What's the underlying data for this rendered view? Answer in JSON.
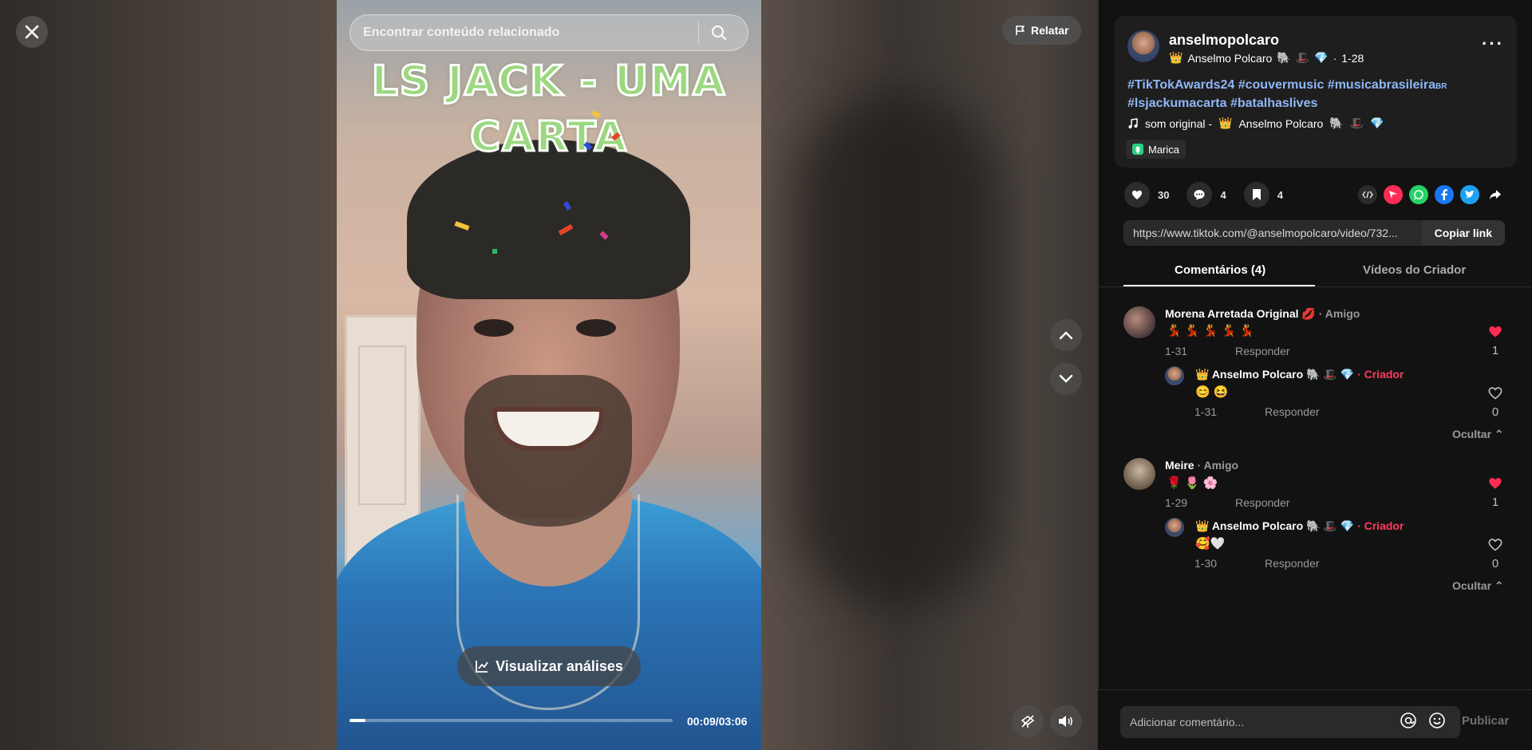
{
  "header": {
    "search_placeholder": "Encontrar conteúdo relacionado",
    "report_label": "Relatar"
  },
  "video": {
    "overlay_title_line1": "LS JACK  -  UMA",
    "overlay_title_line2": "CARTA",
    "analytics_label": "Visualizar análises",
    "timer": "00:09/03:06",
    "progress_fraction": 0.05
  },
  "post": {
    "username": "anselmopolcaro",
    "display_name": "Anselmo Polcaro",
    "date": "1-28",
    "caption_line1": "#TikTokAwards24 #couvermusic #musicabrasileira",
    "caption_flag": "BR",
    "caption_line2": "#lsjackumacarta #batalhaslives",
    "music_prefix": "som original -",
    "music_author": "Anselmo Polcaro",
    "location": "Marica",
    "likes": "30",
    "comments": "4",
    "saves": "4",
    "link": "https://www.tiktok.com/@anselmopolcaro/video/732...",
    "copy_link_label": "Copiar link"
  },
  "tabs": {
    "comments": "Comentários (4)",
    "creator_videos": "Vídeos do Criador"
  },
  "comments": [
    {
      "name": "Morena Arretada Original",
      "tag": "· Amigo",
      "text": "💃 💃 💃 💃 💃",
      "date": "1-31",
      "reply_label": "Responder",
      "likes": "1",
      "liked": true,
      "reply": {
        "name": "Anselmo Polcaro",
        "tag": "· Criador",
        "text": "😊 😆",
        "date": "1-31",
        "reply_label": "Responder",
        "likes": "0"
      },
      "hide_label": "Ocultar"
    },
    {
      "name": "Meire",
      "tag": "· Amigo",
      "text": "🌹 🌷 🌸",
      "date": "1-29",
      "reply_label": "Responder",
      "likes": "1",
      "liked": true,
      "reply": {
        "name": "Anselmo Polcaro",
        "tag": "· Criador",
        "text": "🥰🤍",
        "date": "1-30",
        "reply_label": "Responder",
        "likes": "0"
      },
      "hide_label": "Ocultar"
    }
  ],
  "footer": {
    "comment_placeholder": "Adicionar comentário...",
    "publish_label": "Publicar"
  },
  "colors": {
    "accent_red": "#fe2c55",
    "hashtag_blue": "#8fb7f5",
    "creator_red": "#ff3b5c"
  },
  "icons": [
    "close-icon",
    "flag-icon",
    "search-icon",
    "chevron-up-icon",
    "chevron-down-icon",
    "chart-icon",
    "float-icon",
    "volume-icon",
    "heart-icon",
    "comment-icon",
    "bookmark-icon",
    "embed-icon",
    "share-icon",
    "music-note-icon",
    "location-icon",
    "at-icon",
    "emoji-icon"
  ]
}
